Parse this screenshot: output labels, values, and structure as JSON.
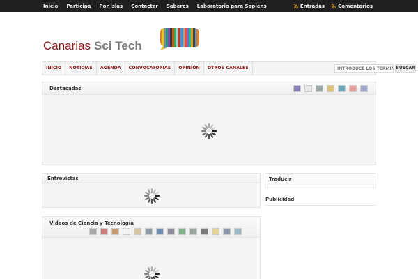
{
  "topnav": {
    "items": [
      "Inicio",
      "Participa",
      "Por islas",
      "Contactar",
      "Saberes",
      "Laboratorio para Sapiens"
    ],
    "feeds": [
      "Entradas",
      "Comentarios"
    ]
  },
  "logo": {
    "part1": "Canarias",
    "part2": "Sci Tech"
  },
  "mainnav": {
    "items": [
      "INICIO",
      "NOTICIAS",
      "AGENDA",
      "CONVOCATORIAS",
      "OPINIÓN",
      "OTROS CANALES"
    ],
    "search_placeholder": "INTRODUCE LOS TÉRMINOS D",
    "search_button": "BUSCAR"
  },
  "destacadas": {
    "title": "Destacadas"
  },
  "entrevistas": {
    "title": "Entrevistas"
  },
  "videos": {
    "title": "Videos de Ciencia y Tecnología"
  },
  "sidebar": {
    "traducir": "Traducir",
    "publicidad": "Publicidad"
  },
  "colors": {
    "topbar": "#202020",
    "brand_red": "#8b1d1d",
    "rss": "#f39c12"
  },
  "icons": {
    "feed": "rss-icon",
    "loading": "loading-spinner-icon"
  }
}
